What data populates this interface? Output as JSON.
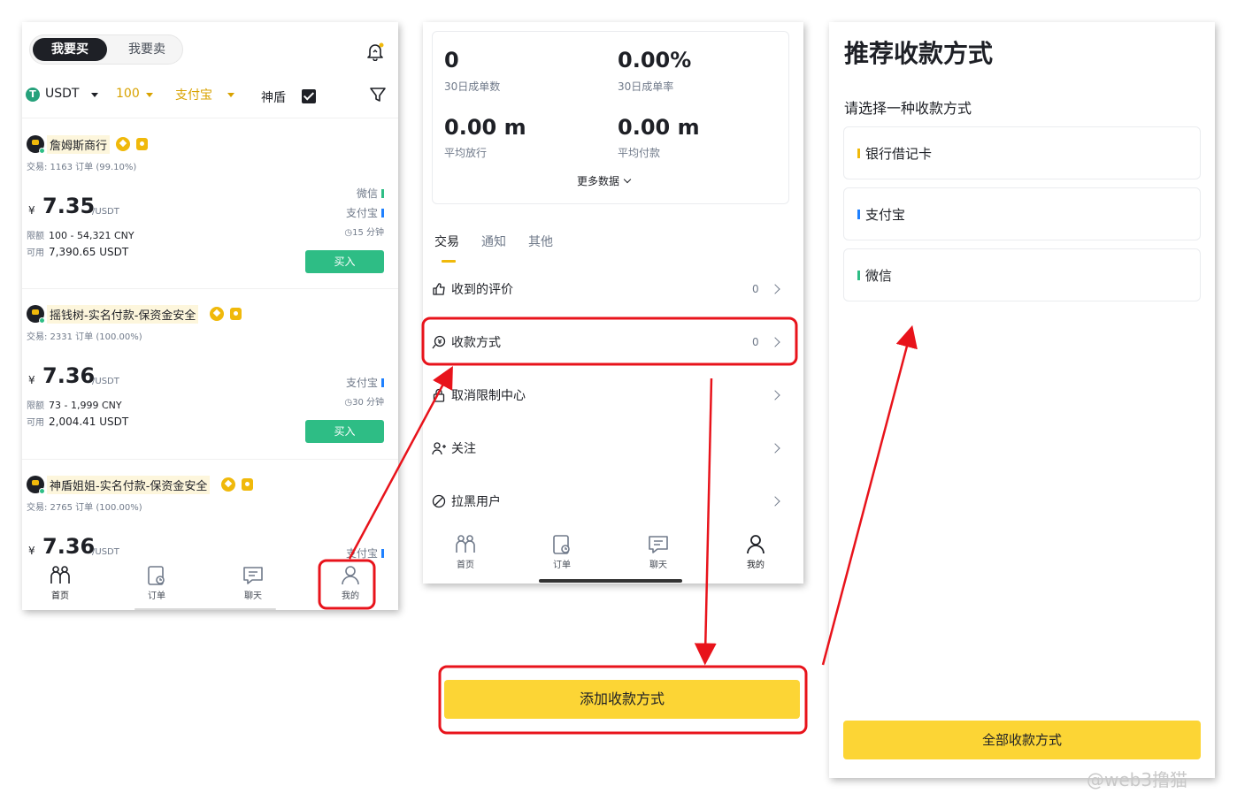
{
  "panel1": {
    "tabs": {
      "buy": "我要买",
      "sell": "我要卖"
    },
    "filters": {
      "coin_icon": "T",
      "coin": "USDT",
      "amount": "100",
      "payment": "支付宝",
      "shield_label": "神盾"
    },
    "ads": [
      {
        "name": "詹姆斯商行",
        "trades": "交易: 1163 订单 (99.10%)",
        "currency": "¥",
        "price": "7.35",
        "unit": "/USDT",
        "limit_label": "限额",
        "limit": "100 - 54,321 CNY",
        "avail_label": "可用",
        "avail": "7,390.65 USDT",
        "payments": [
          "微信",
          "支付宝"
        ],
        "time": "15 分钟",
        "buy": "买入"
      },
      {
        "name": "摇钱树-实名付款-保资金安全",
        "trades": "交易: 2331 订单 (100.00%)",
        "currency": "¥",
        "price": "7.36",
        "unit": "/USDT",
        "limit_label": "限额",
        "limit": "73 - 1,999 CNY",
        "avail_label": "可用",
        "avail": "2,004.41 USDT",
        "payments": [
          "支付宝"
        ],
        "time": "30 分钟",
        "buy": "买入"
      },
      {
        "name": "神盾姐姐-实名付款-保资金安全",
        "trades": "交易: 2765 订单 (100.00%)",
        "currency": "¥",
        "price": "7.36",
        "unit": "/USDT",
        "payments": [
          "支付宝"
        ]
      }
    ],
    "nav": [
      "首页",
      "订单",
      "聊天",
      "我的"
    ]
  },
  "panel2": {
    "stats": [
      {
        "value": "0",
        "label": "30日成单数"
      },
      {
        "value": "0.00%",
        "label": "30日成单率"
      },
      {
        "value": "0.00 m",
        "label": "平均放行"
      },
      {
        "value": "0.00 m",
        "label": "平均付款"
      }
    ],
    "more_data": "更多数据",
    "tabs": [
      "交易",
      "通知",
      "其他"
    ],
    "menu": [
      {
        "label": "收到的评价",
        "count": "0"
      },
      {
        "label": "收款方式",
        "count": "0"
      },
      {
        "label": "取消限制中心"
      },
      {
        "label": "关注"
      },
      {
        "label": "拉黑用户"
      }
    ],
    "nav": [
      "首页",
      "订单",
      "聊天",
      "我的"
    ]
  },
  "add_payment_button": "添加收款方式",
  "panel3": {
    "title": "推荐收款方式",
    "subtitle": "请选择一种收款方式",
    "methods": [
      "银行借记卡",
      "支付宝",
      "微信"
    ],
    "all_button": "全部收款方式"
  },
  "watermark": "@web3撸猫",
  "colors": {
    "accent_yellow": "#fcd535",
    "buy_green": "#2ebd85",
    "annotation_red": "#e8131b",
    "text_dark": "#1e2026",
    "text_grey": "#707a8a"
  }
}
